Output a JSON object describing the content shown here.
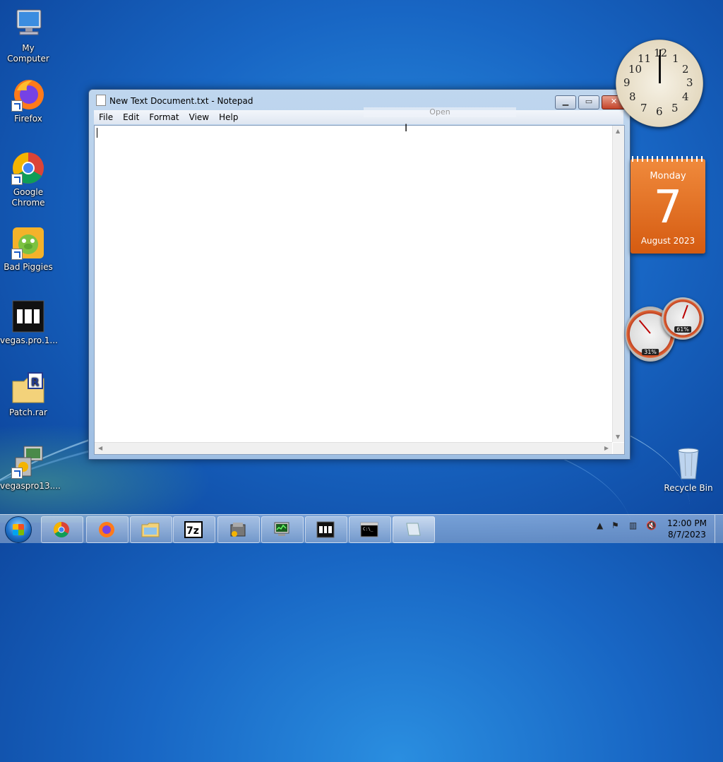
{
  "desktop": {
    "icons": [
      {
        "label": "My Computer"
      },
      {
        "label": "Firefox"
      },
      {
        "label": "Google Chrome"
      },
      {
        "label": "Bad Piggies"
      },
      {
        "label": "vegas.pro.1..."
      },
      {
        "label": "Patch.rar"
      },
      {
        "label": "vegaspro13...."
      }
    ],
    "recycle_bin": {
      "label": "Recycle Bin"
    }
  },
  "notepad": {
    "title": "New Text Document.txt - Notepad",
    "menu": [
      "File",
      "Edit",
      "Format",
      "View",
      "Help"
    ],
    "tooltip": "Open",
    "content": ""
  },
  "gadgets": {
    "clock_numbers": [
      "12",
      "1",
      "2",
      "3",
      "4",
      "5",
      "6",
      "7",
      "8",
      "9",
      "10",
      "11"
    ],
    "calendar": {
      "day_name": "Monday",
      "day": "7",
      "month_year": "August 2023"
    },
    "meters": {
      "cpu": "31%",
      "memory": "61%"
    }
  },
  "taskbar": {
    "buttons": [
      "chrome",
      "firefox",
      "file-explorer",
      "7zip",
      "installer",
      "task-manager",
      "vegas",
      "command-prompt",
      "notepad"
    ],
    "time": "12:00 PM",
    "date": "8/7/2023"
  }
}
